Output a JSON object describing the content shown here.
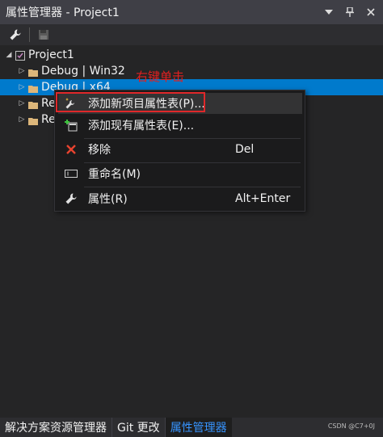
{
  "window": {
    "title": "属性管理器 - Project1",
    "buttons": [
      "dropdown-icon",
      "pin-icon",
      "close-icon"
    ]
  },
  "toolbar": {
    "items": [
      {
        "icon": "wrench-icon",
        "enabled": true
      },
      {
        "icon": "save-icon",
        "enabled": false
      }
    ]
  },
  "tree": {
    "root": {
      "label": "Project1",
      "expanded": true
    },
    "items": [
      {
        "label": "Debug | Win32",
        "selected": false
      },
      {
        "label": "Debug | x64",
        "selected": true
      },
      {
        "label": "Re",
        "selected": false
      },
      {
        "label": "Rel",
        "selected": false
      }
    ]
  },
  "annotation": "右键单击",
  "context_menu": {
    "items": [
      {
        "label": "添加新项目属性表(P)...",
        "shortcut": "",
        "icon": "add-new-sheet-icon",
        "highlighted": true
      },
      {
        "label": "添加现有属性表(E)...",
        "shortcut": "",
        "icon": "add-existing-sheet-icon",
        "highlighted": false
      },
      {
        "label": "移除",
        "shortcut": "Del",
        "icon": "remove-icon",
        "highlighted": false
      },
      {
        "label": "重命名(M)",
        "shortcut": "",
        "icon": "rename-icon",
        "highlighted": false
      },
      {
        "label": "属性(R)",
        "shortcut": "Alt+Enter",
        "icon": "properties-wrench-icon",
        "highlighted": false
      }
    ]
  },
  "bottom_tabs": [
    {
      "label": "解决方案资源管理器",
      "active": false
    },
    {
      "label": "Git 更改",
      "active": false
    },
    {
      "label": "属性管理器",
      "active": true
    }
  ],
  "watermark": "CSDN @C7+0J",
  "colors": {
    "accent": "#007acc",
    "annotation": "#e02020",
    "menu_bg": "#1b1b1c"
  }
}
